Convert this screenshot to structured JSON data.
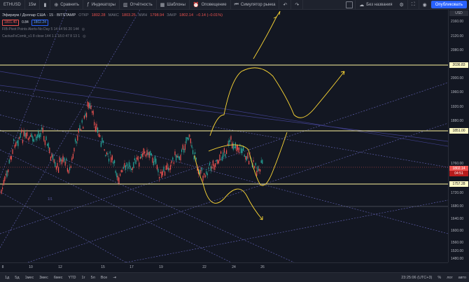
{
  "toolbar": {
    "symbol": "ETHUSD",
    "interval": "15м",
    "compare": "Сравнить",
    "indicators": "Индикаторы",
    "financials": "Отчётность",
    "templates": "Шаблоны",
    "alert": "Оповещение",
    "replay": "Симулятор рынка",
    "layout_name": "Без названия",
    "publish": "Опубликовать"
  },
  "legend": {
    "title": "Эфириум / Доллар США · 15 · BITSTAMP",
    "open_label": "ОТКР",
    "open_value": "1802.28",
    "high_label": "МАКС",
    "high_value": "1803.25",
    "low_label": "МИН",
    "low_value": "1798.94",
    "close_label": "ЗАКР",
    "close_value": "1802.14",
    "change": "−0.14 (−0.01%)",
    "bid": "1801.40",
    "spread": "0.84",
    "ask": "1802.24",
    "indicator1": "FIB-Pivot Points Alerts-No Day 5 14 14 56 20 144",
    "indicator2": "CactusFxComb_v1 8 close 144 1.1 18.0 47 8 13 1"
  },
  "price_scale": {
    "labels": [
      "2160.00",
      "2120.00",
      "2080.00",
      "2000.00",
      "1960.00",
      "1920.00",
      "1880.00",
      "1760.00",
      "1720.00",
      "1680.00",
      "1640.00",
      "1600.00",
      "1560.00",
      "1520.00",
      "1480.00"
    ],
    "tag_top": "2036.83",
    "tag_mid": "1851.00",
    "tag_price": "1802.14",
    "tag_countdown": "04:51",
    "tag_low": "1757.28",
    "tag_top_label": "USD"
  },
  "time_axis": {
    "labels": [
      "8",
      "10",
      "12",
      "15",
      "17",
      "19",
      "22",
      "24",
      "26"
    ]
  },
  "bottom": {
    "ranges": [
      "1д",
      "5д",
      "1мес",
      "3мес",
      "6мес",
      "YTD",
      "1г",
      "5л",
      "Все"
    ],
    "clock": "23:25:06 (UTC+3)",
    "percent": "%",
    "log": "лог",
    "auto": "авто"
  },
  "annotations": {
    "wave_label": "1/1"
  },
  "colors": {
    "background": "#131722",
    "up": "#26a69a",
    "down": "#ef5350",
    "level": "#fff59d",
    "trend": "#5c5ca8",
    "publish": "#2962ff"
  }
}
